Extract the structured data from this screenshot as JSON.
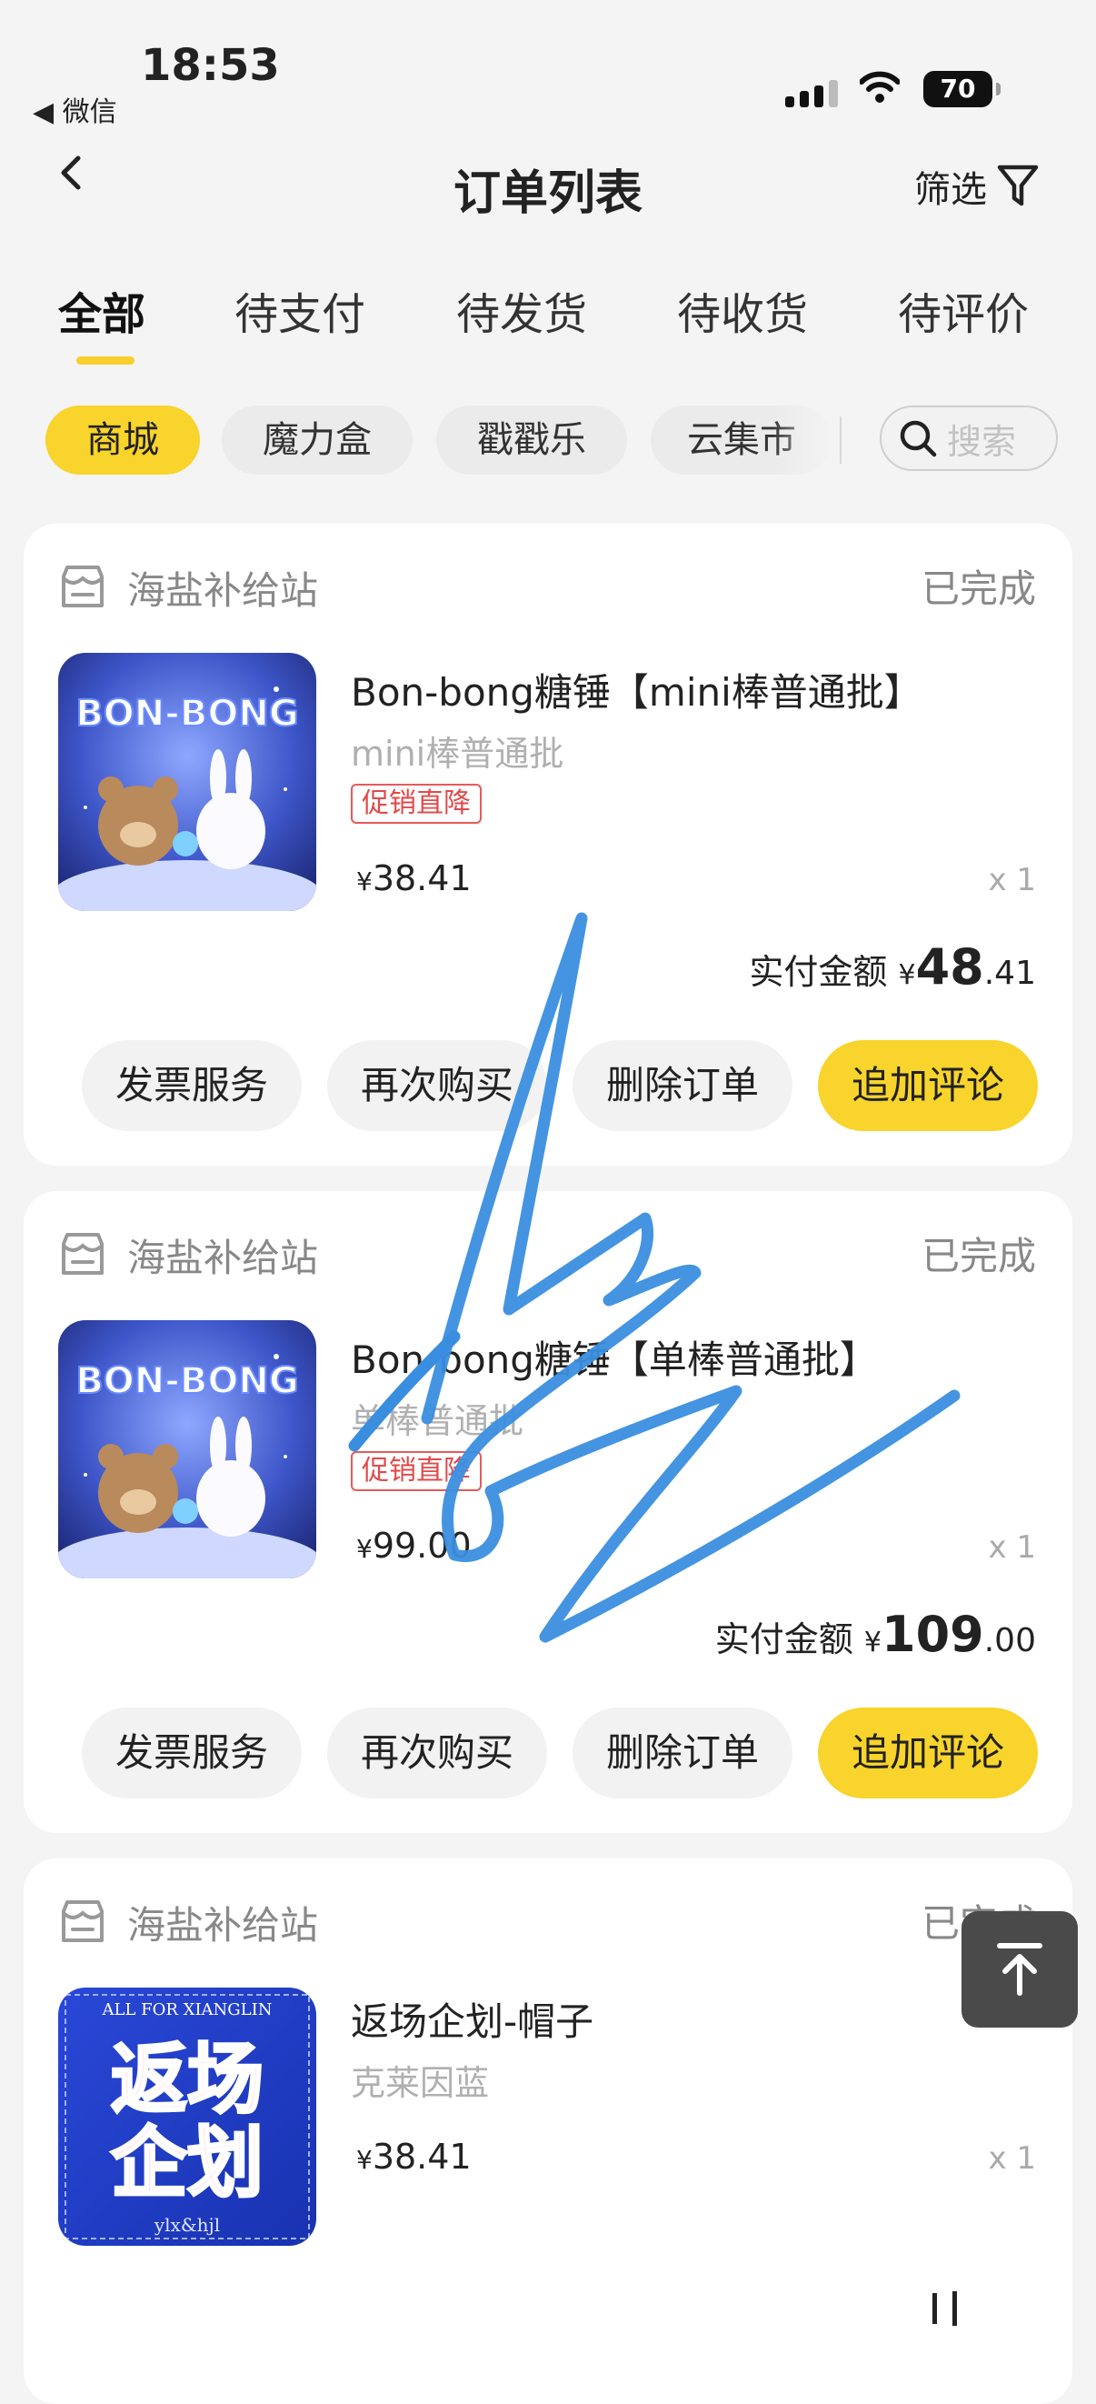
{
  "status_bar": {
    "time": "18:53",
    "back_app": "◀ 微信",
    "battery": "70"
  },
  "nav": {
    "title": "订单列表",
    "filter_label": "筛选"
  },
  "tabs": [
    {
      "label": "全部",
      "active": true
    },
    {
      "label": "待支付"
    },
    {
      "label": "待发货"
    },
    {
      "label": "待收货"
    },
    {
      "label": "待评价"
    }
  ],
  "chips": [
    {
      "label": "商城",
      "active": true
    },
    {
      "label": "魔力盒"
    },
    {
      "label": "戳戳乐"
    },
    {
      "label": "云集市"
    }
  ],
  "search": {
    "placeholder": "搜索"
  },
  "orders": [
    {
      "shop": "海盐补给站",
      "status": "已完成",
      "product": "Bon-bong糖锤【mini棒普通批】",
      "spec": "mini棒普通批",
      "promo": "促销直降",
      "price": "38.41",
      "currency": "¥",
      "qty": "x 1",
      "paid_label": "实付金额",
      "paid_int": "48",
      "paid_dec": ".41",
      "buttons": [
        "发票服务",
        "再次购买",
        "删除订单",
        "追加评论"
      ]
    },
    {
      "shop": "海盐补给站",
      "status": "已完成",
      "product": "Bon-bong糖锤【单棒普通批】",
      "spec": "单棒普通批",
      "promo": "促销直降",
      "price": "99.00",
      "currency": "¥",
      "qty": "x 1",
      "paid_label": "实付金额",
      "paid_int": "109",
      "paid_dec": ".00",
      "buttons": [
        "发票服务",
        "再次购买",
        "删除订单",
        "追加评论"
      ]
    },
    {
      "shop": "海盐补给站",
      "status": "已完成",
      "product": "返场企划-帽子",
      "spec": "克莱因蓝",
      "price": "38.41",
      "currency": "¥",
      "qty": "x 1"
    }
  ],
  "thumbs": {
    "bonbong_text": "BON-BONG",
    "revival_text_1": "返场",
    "revival_text_2": "企划",
    "revival_top": "ALL FOR XIANGLIN",
    "revival_bottom": "ylx&hjl"
  },
  "colors": {
    "accent": "#f8d42c",
    "promo": "#e24a4a",
    "scribble": "#3a8ee0"
  }
}
